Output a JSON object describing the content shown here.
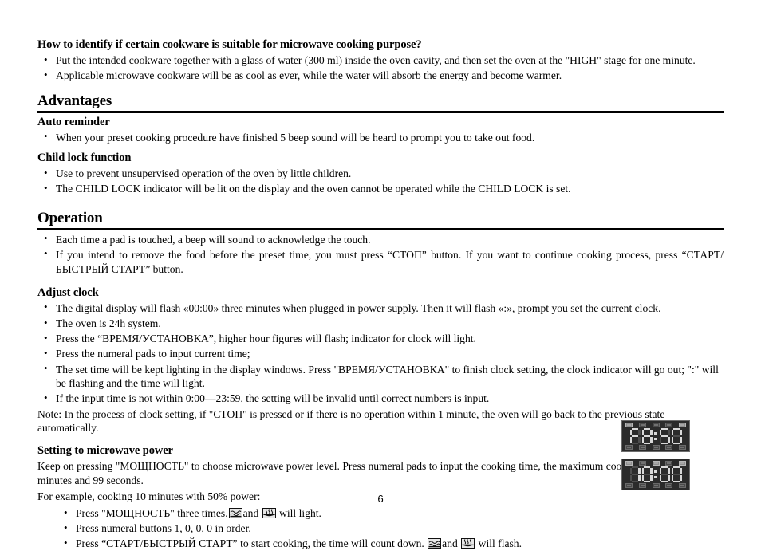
{
  "document": {
    "page_number": "6"
  },
  "cookware_section": {
    "heading": "How to identify if certain cookware is suitable for microwave cooking purpose?",
    "bullets": [
      "Put the intended cookware together with a glass of water (300 ml) inside the oven cavity, and then set the oven at the \"HIGH\" stage for one minute.",
      "Applicable microwave cookware will be as cool as ever, while the water will absorb the energy and become warmer."
    ]
  },
  "advantages": {
    "heading": "Advantages",
    "auto_reminder": {
      "heading": "Auto reminder",
      "bullets": [
        "When your preset cooking procedure have finished 5 beep sound will be heard to prompt you to take out food."
      ]
    },
    "child_lock": {
      "heading": "Child lock function",
      "bullets": [
        "Use to prevent unsupervised operation of the oven by little children.",
        "The CHILD LOCK indicator will be lit on the display and the oven cannot be operated while the CHILD LOCK is set."
      ]
    }
  },
  "operation": {
    "heading": "Operation",
    "bullets": [
      "Each time a pad is touched, a beep will sound to acknowledge the touch.",
      "If you intend to remove the food before the preset time, you must press “СТОП” button. If you want to continue cooking process, press “СТАРТ/БЫСТРЫЙ СТАРТ” button."
    ],
    "adjust_clock": {
      "heading": "Adjust clock",
      "bullets": [
        "The digital display will flash «00:00» three minutes when plugged in power supply. Then it will flash «:», prompt you set the current clock.",
        "The oven is 24h system.",
        "Press the “ВРЕМЯ/УСТАНОВКА”, higher hour figures will flash; indicator for clock will light.",
        "Press the numeral pads to input current time;",
        "The set time will be kept lighting in the display windows. Press \"ВРЕМЯ/УСТАНОВКА\" to finish clock setting, the clock indicator will go out; \":\" will be flashing and the time will light.",
        "If the input time is not within 0:00—23:59, the setting will be invalid until correct numbers is input."
      ],
      "note": "Note: In the process of clock setting, if \"СТОП\" is pressed or if there is no operation within 1 minute, the oven will go back to the previous state automatically."
    },
    "microwave_power": {
      "heading": "Setting to microwave power",
      "intro": "Keep on pressing \"МОЩНОСТЬ\" to choose microwave power level. Press numeral pads to input the cooking time, the maximum cooking time is 99 minutes and 99 seconds.",
      "example_intro": "For example, cooking 10 minutes with 50% power:",
      "steps": {
        "step1_a": "Press \"МОЩНОСТЬ\" three times.",
        "step1_b": "and",
        "step1_c": "will light.",
        "step2": "Press numeral buttons 1, 0, 0, 0 in order.",
        "step3_a": "Press “СТАРТ/БЫСТРЫЙ СТАРТ” to start cooking, the time will count down.",
        "step3_b": "and",
        "step3_c": "will flash."
      }
    }
  },
  "led_displays": [
    {
      "name": "power-level-display",
      "value": "P8:50",
      "digits": [
        "P",
        "8",
        "5",
        "0"
      ],
      "colon": ":"
    },
    {
      "name": "cooking-time-display",
      "value": "10:00",
      "digits": [
        "1",
        "0",
        "0",
        "0"
      ],
      "colon": ":"
    }
  ],
  "colors": {
    "text": "#000000",
    "background": "#ffffff",
    "rule": "#000000",
    "led_panel_bg": "#2b2b2b",
    "led_segment_on": "#d9d9d9",
    "led_segment_off": "#4d4d4d"
  }
}
